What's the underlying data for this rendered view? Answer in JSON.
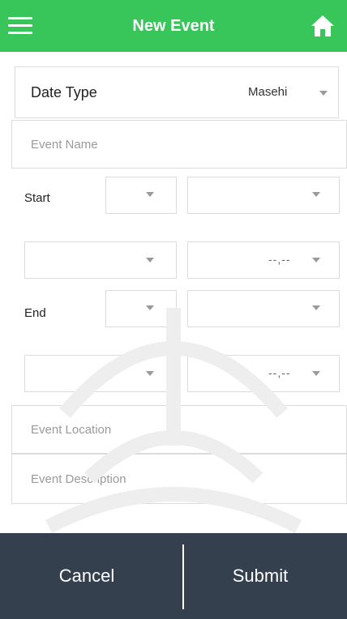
{
  "header": {
    "title": "New Event",
    "menu_icon": "hamburger-menu-icon",
    "home_icon": "home-icon",
    "color": "#38c55a"
  },
  "form": {
    "date_type": {
      "label": "Date Type",
      "value": "Masehi"
    },
    "event_name": {
      "placeholder": "Event Name"
    },
    "start": {
      "label": "Start",
      "time_value": "--,--"
    },
    "end": {
      "label": "End",
      "time_value": "--,--"
    },
    "event_location": {
      "placeholder": "Event Location"
    },
    "event_description": {
      "placeholder": "Event Description"
    }
  },
  "footer": {
    "cancel_label": "Cancel",
    "submit_label": "Submit",
    "color": "#34404d"
  }
}
